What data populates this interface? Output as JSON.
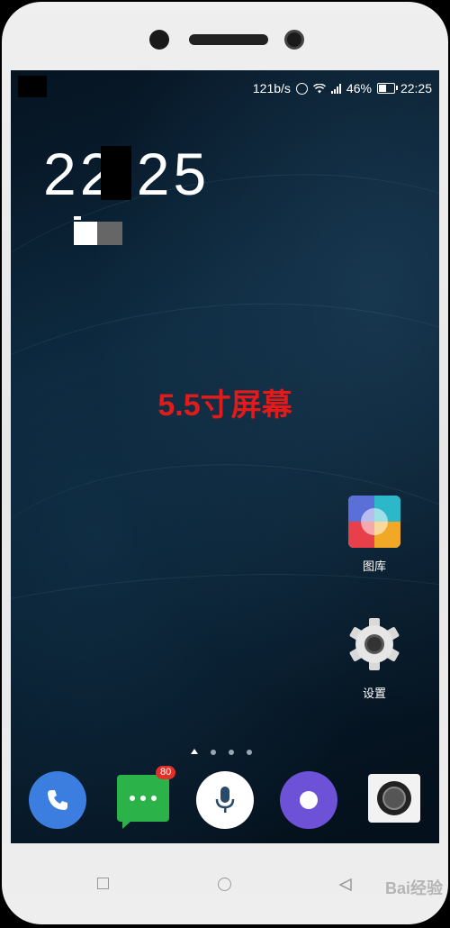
{
  "status_bar": {
    "net_speed": "121b/s",
    "battery_percent": "46%",
    "battery_level": 0.46,
    "time": "22:25"
  },
  "lock_clock": {
    "time": "22:25"
  },
  "annotation": {
    "text": "5.5寸屏幕"
  },
  "home_apps": [
    {
      "label": "图库",
      "icon": "gallery-icon"
    },
    {
      "label": "设置",
      "icon": "gear-icon"
    }
  ],
  "page_indicator": {
    "pages": 4,
    "current": 0,
    "home_icon": "home-icon"
  },
  "dock": [
    {
      "icon": "phone-icon",
      "color": "#3b7ee0"
    },
    {
      "icon": "messages-icon",
      "color": "#2bb34a",
      "badge": "80"
    },
    {
      "icon": "microphone-icon",
      "color": "#ffffff"
    },
    {
      "icon": "browser-icon",
      "color": "#6d52d8"
    },
    {
      "icon": "camera-icon",
      "color": "#f2f2f2"
    }
  ],
  "nav_bar": {
    "icons": [
      "recents-icon",
      "home-icon",
      "back-icon"
    ]
  },
  "watermark": {
    "text": "Bai经验"
  },
  "colors": {
    "annotation": "#e21a1a",
    "badge": "#e0302a"
  }
}
